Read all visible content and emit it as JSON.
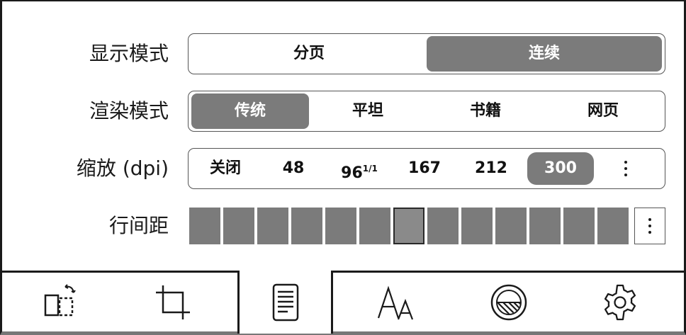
{
  "settings": {
    "display_mode": {
      "label": "显示模式",
      "options": [
        "分页",
        "连续"
      ],
      "selected": "连续"
    },
    "render_mode": {
      "label": "渲染模式",
      "options": [
        "传统",
        "平坦",
        "书籍",
        "网页"
      ],
      "selected": "传统"
    },
    "zoom": {
      "label": "缩放 (dpi)",
      "options": [
        "关闭",
        "48",
        "96",
        "167",
        "212",
        "300"
      ],
      "fit_superscript": "1/1",
      "selected": "300"
    },
    "line_spacing": {
      "label": "行间距",
      "level_count": 13,
      "selected_index": 6
    }
  },
  "tabbar": {
    "tabs": [
      {
        "icon": "rotate-page-icon"
      },
      {
        "icon": "crop-icon"
      },
      {
        "icon": "document-icon",
        "active": true
      },
      {
        "icon": "font-size-icon"
      },
      {
        "icon": "contrast-icon"
      },
      {
        "icon": "gear-icon"
      }
    ]
  },
  "colors": {
    "selected": "#7b7b7b",
    "border": "#555555",
    "text": "#1a1a1a"
  }
}
